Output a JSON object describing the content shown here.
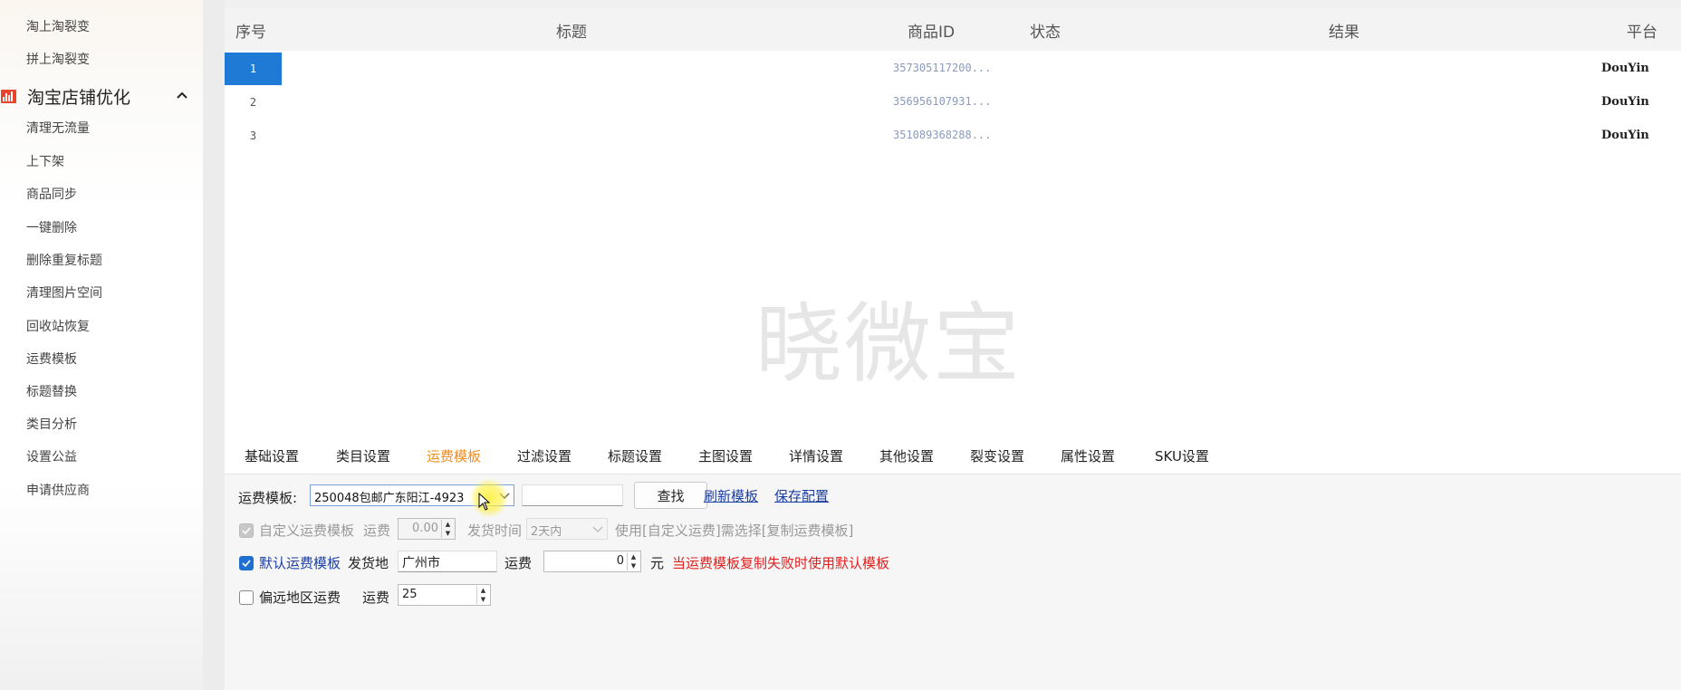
{
  "sidebar": {
    "items_top": [
      "淘上淘裂变",
      "拼上淘裂变"
    ],
    "group": {
      "label": "淘宝店铺优化",
      "icon": "bar-chart-icon",
      "chevron": "chevron-up-icon"
    },
    "items": [
      "清理无流量",
      "上下架",
      "商品同步",
      "一键删除",
      "删除重复标题",
      "清理图片空间",
      "回收站恢复",
      "运费模板",
      "标题替换",
      "类目分析",
      "设置公益",
      "申请供应商"
    ]
  },
  "table": {
    "headers": {
      "index": "序号",
      "title": "标题",
      "product_id": "商品ID",
      "status": "状态",
      "result": "结果",
      "platform": "平台"
    },
    "rows": [
      {
        "index": "1",
        "title": "",
        "product_id": "357305117200...",
        "status": "",
        "result": "",
        "platform": "DouYin",
        "selected": true
      },
      {
        "index": "2",
        "title": "",
        "product_id": "356956107931...",
        "status": "",
        "result": "",
        "platform": "DouYin",
        "selected": false
      },
      {
        "index": "3",
        "title": "",
        "product_id": "351089368288...",
        "status": "",
        "result": "",
        "platform": "DouYin",
        "selected": false
      }
    ],
    "watermark": "晓微宝"
  },
  "tabs": [
    {
      "label": "基础设置",
      "active": false
    },
    {
      "label": "类目设置",
      "active": false
    },
    {
      "label": "运费模板",
      "active": true
    },
    {
      "label": "过滤设置",
      "active": false
    },
    {
      "label": "标题设置",
      "active": false
    },
    {
      "label": "主图设置",
      "active": false
    },
    {
      "label": "详情设置",
      "active": false
    },
    {
      "label": "其他设置",
      "active": false
    },
    {
      "label": "裂变设置",
      "active": false
    },
    {
      "label": "属性设置",
      "active": false
    },
    {
      "label": "SKU设置",
      "active": false
    }
  ],
  "freight": {
    "template_label": "运费模板:",
    "template_value": "250048包邮广东阳江-4923",
    "search_value": "",
    "search_button": "查找",
    "refresh_link": "刷新模板",
    "save_link": "保存配置",
    "custom": {
      "checkbox_label": "自定义运费模板",
      "fee_label": "运费",
      "fee_value": "0.00",
      "ship_time_label": "发货时间",
      "ship_time_value": "2天内",
      "hint": "使用[自定义运费]需选择[复制运费模板]"
    },
    "default": {
      "checkbox_label": "默认运费模板",
      "origin_label": "发货地",
      "origin_value": "广州市",
      "fee_label": "运费",
      "fee_value": "0",
      "unit": "元",
      "warning": "当运费模板复制失败时使用默认模板"
    },
    "remote": {
      "checkbox_label": "偏远地区运费",
      "fee_label": "运费",
      "fee_value": "25"
    }
  },
  "colors": {
    "accent": "#1f7ad6",
    "active_tab": "#f28c1a",
    "warning": "#e02020",
    "link": "#1d3fa3"
  }
}
